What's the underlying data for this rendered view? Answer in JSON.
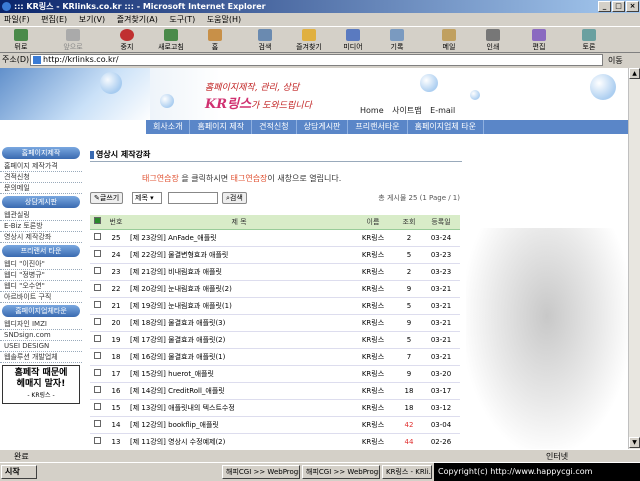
{
  "window": {
    "title": "::: KR링스 - KRlinks.co.kr ::: - Microsoft Internet Explorer",
    "minimize": "_",
    "maximize": "□",
    "close": "×"
  },
  "menu": [
    "파일(F)",
    "편집(E)",
    "보기(V)",
    "즐겨찾기(A)",
    "도구(T)",
    "도움말(H)"
  ],
  "toolbar": [
    "뒤로",
    "앞으로",
    "중지",
    "새로고침",
    "홈",
    "검색",
    "즐겨찾기",
    "미디어",
    "기록",
    "메일",
    "인쇄",
    "편집",
    "토론"
  ],
  "address": {
    "label": "주소(D)",
    "url": "http://krlinks.co.kr/",
    "go": "이동"
  },
  "header": {
    "slogan_prefix": "홈페이지제작, 관리, 상담",
    "brand": "KR링스",
    "slogan_suffix": "가 도와드립니다",
    "links": [
      "Home",
      "사이트맵",
      "E-mail"
    ]
  },
  "topnav": [
    "회사소개",
    "홈페이지 제작",
    "견적신청",
    "상담게시판",
    "프리랜서타운",
    "홈페이지업체 타운"
  ],
  "sidebar": {
    "sections": [
      {
        "head": "홈페이지제작",
        "items": [
          "홈페이지 제작가격",
          "견적신청",
          "문의메일"
        ]
      },
      {
        "head": "상담게시판",
        "items": [
          "웹관실링",
          "E-Biz 토론방",
          "영상시 제작강좌"
        ]
      },
      {
        "head": "프리랜서 타운",
        "items": [
          "웹디 \"이진아\"",
          "웹디 \"정병규\"",
          "웹디 \"오수연\"",
          "아르바이트 구직"
        ]
      },
      {
        "head": "홈페이지업체타운",
        "items": [
          "웹디자인 IMZI",
          "SNDsign.com",
          "USEI DESIGN",
          "웹솔루션 개발업체"
        ]
      }
    ],
    "ad": {
      "line1": "홈페작 때문에",
      "line2": "헤매지 말자!",
      "line3": "- KR링스 -"
    }
  },
  "main": {
    "title": "영상시 제작강좌",
    "note_hl1": "태그연습장",
    "note_mid": " 을 클릭하시면 ",
    "note_hl2": "태그연습장",
    "note_end": "이 새창으로 열립니다.",
    "write_button": "글쓰기",
    "search_field": "제목",
    "search_button": "검색",
    "count": "총 게시물 25 (1 Page / 1)",
    "columns": [
      "번호",
      "제 목",
      "이름",
      "조회",
      "등록일"
    ],
    "rows": [
      [
        "25",
        "[제 23강의] AnFade_애플릿",
        "KR링스",
        "2",
        "03-24"
      ],
      [
        "24",
        "[제 22강의] 물결변형효과 애플릿",
        "KR링스",
        "5",
        "03-23"
      ],
      [
        "23",
        "[제 21강의] 비내림효과 애플릿",
        "KR링스",
        "2",
        "03-23"
      ],
      [
        "22",
        "[제 20강의] 눈내림효과 애플릿(2)",
        "KR링스",
        "9",
        "03-21"
      ],
      [
        "21",
        "[제 19강의] 눈내림효과 애플릿(1)",
        "KR링스",
        "5",
        "03-21"
      ],
      [
        "20",
        "[제 18강의] 물결효과 애플릿(3)",
        "KR링스",
        "9",
        "03-21"
      ],
      [
        "19",
        "[제 17강의] 물결효과 애플릿(2)",
        "KR링스",
        "5",
        "03-21"
      ],
      [
        "18",
        "[제 16강의] 물결효과 애플릿(1)",
        "KR링스",
        "7",
        "03-21"
      ],
      [
        "17",
        "[제 15강의] huerot_애플릿",
        "KR링스",
        "9",
        "03-20"
      ],
      [
        "16",
        "[제 14강의] CreditRoll_애플릿",
        "KR링스",
        "18",
        "03-17"
      ],
      [
        "15",
        "[제 13강의] 애플릿내의 텍스트수정",
        "KR링스",
        "18",
        "03-12"
      ],
      [
        "14",
        "[제 12강의] bookflip_애플릿",
        "KR링스",
        "42",
        "03-04"
      ],
      [
        "13",
        "[제 11강의] 영상시 수정예제(2)",
        "KR링스",
        "44",
        "02-26"
      ]
    ]
  },
  "status": {
    "text": "완료",
    "zone": "인터넷"
  },
  "taskbar": {
    "start": "시작",
    "tasks": [
      "해피CGI >> WebProgr...",
      "해피CGI >> WebProgr...",
      "KR링스 - KRli..."
    ],
    "copyright": "Copyright(c) http://www.happycgi.com"
  },
  "colors": {
    "titlebar": "#0a246a",
    "nav": "#5a86c8",
    "hot": "#e03030",
    "table_head": "#d8ecc8"
  }
}
